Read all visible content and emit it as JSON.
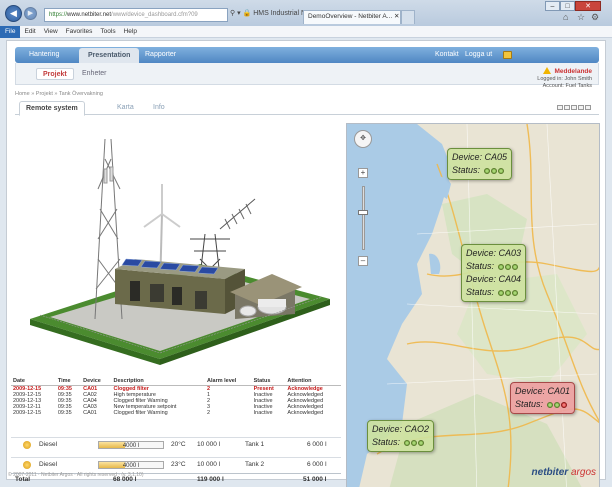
{
  "browser": {
    "url_secure": "https://",
    "url_host": "www.netbiter.net",
    "url_path": "/www/device_dashboard.cfm?09",
    "addr_buttons": "⚲ ▾ 🔒 HMS Industrial Ne... ↻ C ✕",
    "tabs": [
      {
        "label": "DemoOverview - Netbiter A... ✕"
      }
    ],
    "menu": [
      "File",
      "Edit",
      "View",
      "Favorites",
      "Tools",
      "Help"
    ]
  },
  "app_nav": {
    "items": [
      "Hantering",
      "Presentation",
      "Rapporter"
    ],
    "right": [
      "Kontakt",
      "Logga ut"
    ]
  },
  "sub_nav": [
    "Projekt",
    "Enheter"
  ],
  "user": {
    "message": "Meddelande",
    "logged_in": "Logged in: John Smith",
    "account": "Account: Fuel Tanks"
  },
  "breadcrumb": "Home » Projekt » Tank Övervakning",
  "page_tabs": [
    "Remote system",
    "Karta",
    "Info"
  ],
  "alarm_table": {
    "headers": [
      "Date",
      "Time",
      "Device",
      "Description",
      "Alarm level",
      "Status",
      "Attention"
    ],
    "rows": [
      {
        "date": "2009-12-15",
        "time": "09:35",
        "device": "CA01",
        "desc": "Clogged filter",
        "level": "2",
        "status": "Present",
        "attention": "Acknowledge",
        "hot": true
      },
      {
        "date": "2009-12-15",
        "time": "09:35",
        "device": "CA02",
        "desc": "High temperature",
        "level": "1",
        "status": "Inactive",
        "attention": "Acknowledged",
        "hot": false
      },
      {
        "date": "2009-12-13",
        "time": "09:35",
        "device": "CA04",
        "desc": "Clogged filter Warning",
        "level": "2",
        "status": "Inactive",
        "attention": "Acknowledged",
        "hot": false
      },
      {
        "date": "2009-12-11",
        "time": "09:35",
        "device": "CA03",
        "desc": "New temperature setpoint",
        "level": "3",
        "status": "Inactive",
        "attention": "Acknowledged",
        "hot": false
      },
      {
        "date": "2009-12-15",
        "time": "09:35",
        "device": "CA01",
        "desc": "Clogged filter Warning",
        "level": "2",
        "status": "Inactive",
        "attention": "Acknowledged",
        "hot": false
      }
    ]
  },
  "tanks": [
    {
      "fuel": "Diesel",
      "volume": "4000 l",
      "fill_fraction": 0.4,
      "temp": "20°C",
      "capacity": "10 000 l",
      "name": "Tank 1",
      "free": "6 000 l"
    },
    {
      "fuel": "Diesel",
      "volume": "4000 l",
      "fill_fraction": 0.4,
      "temp": "23°C",
      "capacity": "10 000 l",
      "name": "Tank 2",
      "free": "6 000 l"
    }
  ],
  "totals": {
    "label": "Total",
    "volume": "68 000 l",
    "capacity": "119 000 l",
    "free": "51 000 l"
  },
  "map": {
    "devices": [
      {
        "device": "Device: CA05",
        "status": "Status:",
        "lights": [
          "g",
          "g",
          "g"
        ]
      },
      {
        "device": "Device: CA03",
        "status": "Status:",
        "lights": [
          "g",
          "g",
          "g"
        ]
      },
      {
        "device": "Device: CA04",
        "status": "Status:",
        "lights": [
          "g",
          "g",
          "g"
        ]
      },
      {
        "device": "Device: CA01",
        "status": "Status:",
        "lights": [
          "g",
          "g",
          "r"
        ]
      },
      {
        "device": "Device: CAO2",
        "status": "Status:",
        "lights": [
          "g",
          "g",
          "g"
        ]
      }
    ]
  },
  "footer": {
    "copyright": "© 2007-2011 · Netbiter Argos · All rights reserved · (v. 3.1.10)",
    "brand": "netbiter",
    "brand_suffix": "argos"
  }
}
